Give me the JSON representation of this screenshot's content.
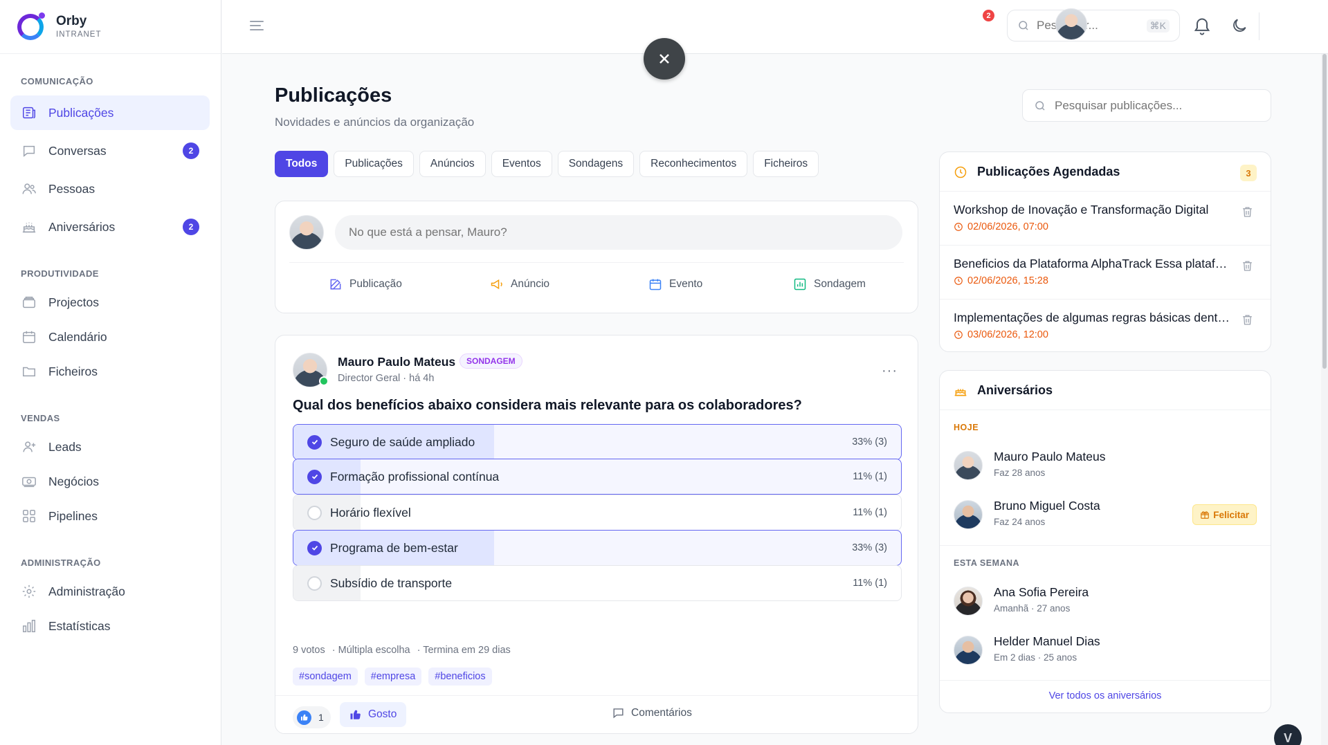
{
  "brand": {
    "name": "Orby",
    "sub": "INTRANET"
  },
  "sidebar": {
    "sections": [
      {
        "title": "COMUNICAÇÃO",
        "items": [
          {
            "label": "Publicações",
            "icon": "newspaper-icon",
            "active": true
          },
          {
            "label": "Conversas",
            "icon": "chat-icon",
            "badge": "2"
          },
          {
            "label": "Pessoas",
            "icon": "people-icon"
          },
          {
            "label": "Aniversários",
            "icon": "cake-icon",
            "badge": "2"
          }
        ]
      },
      {
        "title": "PRODUTIVIDADE",
        "items": [
          {
            "label": "Projectos",
            "icon": "folder-stack-icon"
          },
          {
            "label": "Calendário",
            "icon": "calendar-icon"
          },
          {
            "label": "Ficheiros",
            "icon": "folder-icon"
          }
        ]
      },
      {
        "title": "VENDAS",
        "items": [
          {
            "label": "Leads",
            "icon": "user-plus-icon"
          },
          {
            "label": "Negócios",
            "icon": "money-icon"
          },
          {
            "label": "Pipelines",
            "icon": "grid-icon"
          }
        ]
      },
      {
        "title": "ADMINISTRAÇÃO",
        "items": [
          {
            "label": "Administração",
            "icon": "gear-icon"
          },
          {
            "label": "Estatísticas",
            "icon": "bar-chart-icon"
          }
        ]
      }
    ]
  },
  "topbar": {
    "search_placeholder": "Pesquisar...",
    "shortcut": "⌘K",
    "notifications": "2"
  },
  "page": {
    "title": "Publicações",
    "subtitle": "Novidades e anúncios da organização",
    "search_placeholder": "Pesquisar publicações..."
  },
  "tabs": [
    "Todos",
    "Publicações",
    "Anúncios",
    "Eventos",
    "Sondagens",
    "Reconhecimentos",
    "Ficheiros"
  ],
  "composer": {
    "placeholder": "No que está a pensar, Mauro?",
    "actions": [
      {
        "label": "Publicação",
        "icon": "edit-icon",
        "color": "#6366f1"
      },
      {
        "label": "Anúncio",
        "icon": "megaphone-icon",
        "color": "#f59e0b"
      },
      {
        "label": "Evento",
        "icon": "calendar-icon",
        "color": "#3b82f6"
      },
      {
        "label": "Sondagem",
        "icon": "chart-icon",
        "color": "#10b981"
      }
    ]
  },
  "post": {
    "author": "Mauro Paulo Mateus",
    "tag": "SONDAGEM",
    "meta": "Director Geral · há 4h",
    "question": "Qual dos benefícios abaixo considera mais relevante para os colaboradores?",
    "options": [
      {
        "label": "Seguro de saúde ampliado",
        "pct": "33% (3)",
        "share": 33,
        "selected": true
      },
      {
        "label": "Formação profissional contínua",
        "pct": "11% (1)",
        "share": 11,
        "selected": true
      },
      {
        "label": "Horário flexível",
        "pct": "11% (1)",
        "share": 11,
        "selected": false
      },
      {
        "label": "Programa de bem-estar",
        "pct": "33% (3)",
        "share": 33,
        "selected": true
      },
      {
        "label": "Subsídio de transporte",
        "pct": "11% (1)",
        "share": 11,
        "selected": false
      }
    ],
    "votes": "9 votos",
    "type": "· Múltipla escolha",
    "ends": "· Termina em 29 dias",
    "hashtags": [
      "#sondagem",
      "#empresa",
      "#beneficios"
    ],
    "likes": "1",
    "like_label": "Gosto",
    "comments_label": "Comentários"
  },
  "scheduled": {
    "title": "Publicações Agendadas",
    "count": "3",
    "items": [
      {
        "title": "Workshop de Inovação e Transformação Digital",
        "date": "02/06/2026, 07:00"
      },
      {
        "title": "Beneficios da Plataforma AlphaTrack Essa plataforma",
        "date": "02/06/2026, 15:28"
      },
      {
        "title": "Implementações de algumas regras básicas dentro da empresa",
        "date": "03/06/2026, 12:00"
      }
    ]
  },
  "birthdays": {
    "title": "Aniversários",
    "today_label": "HOJE",
    "week_label": "ESTA SEMANA",
    "today": [
      {
        "name": "Mauro Paulo Mateus",
        "sub": "Faz 28 anos"
      },
      {
        "name": "Bruno Miguel Costa",
        "sub": "Faz 24 anos",
        "action": "Felicitar"
      }
    ],
    "week": [
      {
        "name": "Ana Sofia Pereira",
        "sub": "Amanhã · 27 anos"
      },
      {
        "name": "Helder Manuel Dias",
        "sub": "Em 2 dias · 25 anos"
      }
    ],
    "view_all": "Ver todos os aniversários"
  },
  "colors": {
    "accent": "#4f46e5",
    "warning": "#f59e0b",
    "danger": "#ef4444",
    "success": "#22c55e"
  }
}
